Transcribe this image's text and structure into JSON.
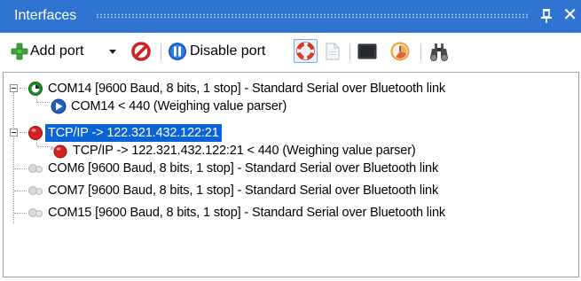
{
  "window": {
    "title": "Interfaces",
    "pin_icon": "pin-icon",
    "close_glyph": "✕"
  },
  "toolbar": {
    "add_port_label": "Add port",
    "add_port_icon": "plus-icon",
    "add_port_dropdown_icon": "chevron-down-icon",
    "remove_icon": "no-entry-icon",
    "disable_port_label": "Disable port",
    "disable_port_icon": "pause-icon",
    "help_icon": "lifebuoy-icon",
    "page_icon": "page-icon",
    "terminal_icon": "terminal-icon",
    "timer_icon": "clock-icon",
    "binoculars_icon": "binoculars-icon"
  },
  "tree": {
    "nodes": [
      {
        "label": "COM14 [9600 Baud, 8 bits, 1 stop] - Standard Serial over Bluetooth link",
        "status": "connected",
        "level": 0,
        "expanded": true
      },
      {
        "label": "COM14 < 440 (Weighing value parser)",
        "status": "playing",
        "level": 1
      },
      {
        "label": "TCP/IP -> 122.321.432.122:21",
        "status": "error",
        "level": 0,
        "expanded": true,
        "selected": true
      },
      {
        "label": "TCP/IP -> 122.321.432.122:21 < 440 (Weighing value parser)",
        "status": "error",
        "level": 1
      },
      {
        "label": "COM6 [9600 Baud, 8 bits, 1 stop] - Standard Serial over Bluetooth link",
        "status": "inactive",
        "level": 0
      },
      {
        "label": "COM7 [9600 Baud, 8 bits, 1 stop] - Standard Serial over Bluetooth link",
        "status": "inactive",
        "level": 0
      },
      {
        "label": "COM15 [9600 Baud, 8 bits, 1 stop] - Standard Serial over Bluetooth link",
        "status": "inactive",
        "level": 0
      }
    ]
  },
  "colors": {
    "titlebar": "#2f74d0",
    "selection": "#0a64d8",
    "connected": "#2a9d2a",
    "error": "#d22525",
    "playing": "#1e6fcf"
  }
}
